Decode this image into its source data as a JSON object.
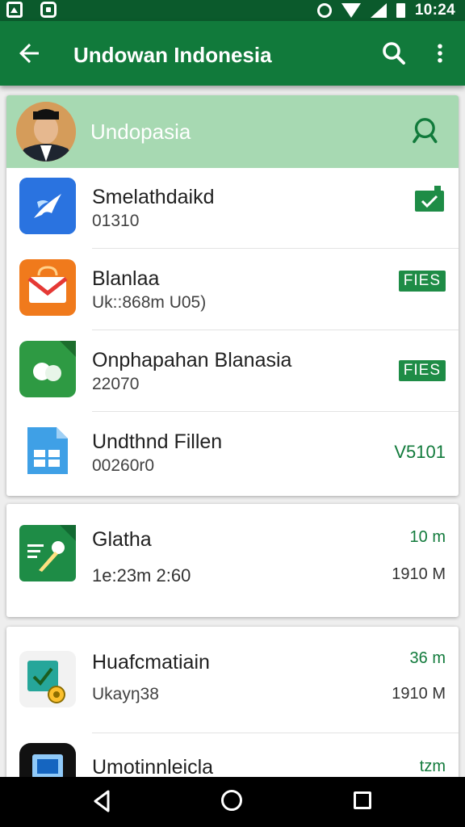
{
  "status_bar": {
    "time": "10:24",
    "left_icons": [
      "image-icon",
      "message-icon"
    ],
    "right_icons": [
      "alarm-icon",
      "wifi-icon",
      "signal-icon",
      "battery-icon"
    ]
  },
  "app_bar": {
    "title": "Undowan Indonesia",
    "icons": [
      "back-arrow-icon",
      "search-icon",
      "more-vert-icon"
    ]
  },
  "card1": {
    "header": {
      "title": "Undopasia",
      "icons": [
        "avatar",
        "search-icon"
      ]
    },
    "items": [
      {
        "title": "Smelathdaikd",
        "subtitle": "01310",
        "icon": "blue-app-icon",
        "right_icon": "check-badge-icon"
      },
      {
        "title": "Blanlaa",
        "subtitle": "Uk::868m U05)",
        "icon": "mail-app-icon",
        "badge": "FIES"
      },
      {
        "title": "Onphapahan Blanasia",
        "subtitle": "22070",
        "icon": "green-chat-app-icon",
        "badge": "FIES"
      },
      {
        "title": "Undthnd Fillen",
        "subtitle": "00260r0",
        "icon": "sheets-app-icon",
        "right_text": "V5101"
      }
    ]
  },
  "card2": {
    "title": "Glatha",
    "subtitle": "1e:23m 2:60",
    "right_top": "10 m",
    "right_bottom": "1910 M",
    "icon": "edit-app-icon"
  },
  "card3": {
    "items": [
      {
        "title": "Huafcmatiain",
        "subtitle": "Ukayŋ38",
        "right_top": "36 m",
        "right_bottom": "1910 M",
        "icon": "task-app-icon"
      },
      {
        "title": "Umotinnleicla",
        "right_top": "tzm",
        "icon": "device-app-icon"
      }
    ]
  },
  "colors": {
    "status_bar": "#0b5a2c",
    "app_bar": "#117a3b",
    "card_header": "#a7d9b2",
    "accent": "#1e8c46"
  },
  "nav_bar": {
    "icons": [
      "nav-back-icon",
      "nav-home-icon",
      "nav-recents-icon"
    ]
  }
}
